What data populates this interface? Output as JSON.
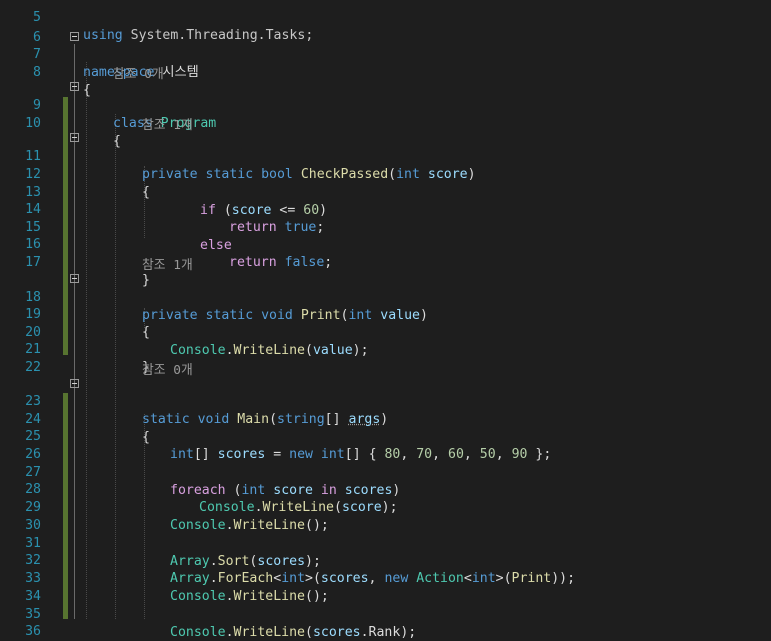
{
  "editor": {
    "line_numbers": [
      "5",
      "6",
      "7",
      "8",
      "9",
      "10",
      "11",
      "12",
      "13",
      "14",
      "15",
      "16",
      "17",
      "18",
      "19",
      "20",
      "21",
      "22",
      "23",
      "24",
      "25",
      "26",
      "27",
      "28",
      "29",
      "30",
      "31",
      "32",
      "33",
      "34",
      "35",
      "36"
    ],
    "codelens": {
      "program": "참조 0개",
      "check_passed": "참조 1개",
      "print": "참조 1개",
      "main": "참조 0개"
    },
    "lines": {
      "l5_using": "using",
      "l5_rest": " System.Threading.Tasks;",
      "l7_kw": "namespace",
      "l7_name": " 시스템",
      "l8": "{",
      "l9_kw": "class",
      "l9_name": "Program",
      "l10": "{",
      "l11_kw": "private static bool",
      "l11_method": "CheckPassed",
      "l11_p1": "(",
      "l11_type": "int",
      "l11_param": "score",
      "l11_p2": ")",
      "l12": "{",
      "l13_kw": "if",
      "l13_p1": " (",
      "l13_var": "score",
      "l13_op": " <= ",
      "l13_num": "60",
      "l13_p2": ")",
      "l14_kw": "return",
      "l14_val": "true",
      "l14_semi": ";",
      "l15_kw": "else",
      "l16_kw": "return",
      "l16_val": "false",
      "l16_semi": ";",
      "l17": "}",
      "l18_kw": "private static void",
      "l18_method": "Print",
      "l18_p1": "(",
      "l18_type": "int",
      "l18_param": "value",
      "l18_p2": ")",
      "l19": "{",
      "l20_type": "Console",
      "l20_dot": ".",
      "l20_method": "WriteLine",
      "l20_p1": "(",
      "l20_var": "value",
      "l20_p2": ");",
      "l21": "}",
      "l23_kw": "static void",
      "l23_method": "Main",
      "l23_p1": "(",
      "l23_type": "string",
      "l23_br": "[]",
      "l23_param": "args",
      "l23_p2": ")",
      "l24": "{",
      "l25_type": "int",
      "l25_br": "[]",
      "l25_var": "scores",
      "l25_eq": " = ",
      "l25_new": "new",
      "l25_type2": "int",
      "l25_br2": "[] { ",
      "l25_n1": "80",
      "l25_n2": "70",
      "l25_n3": "60",
      "l25_n4": "50",
      "l25_n5": "90",
      "l25_end": " };",
      "l25_comma": ", ",
      "l27_kw": "foreach",
      "l27_p1": " (",
      "l27_type": "int",
      "l27_var": "score",
      "l27_in": "in",
      "l27_var2": "scores",
      "l27_p2": ")",
      "l28_type": "Console",
      "l28_dot": ".",
      "l28_method": "WriteLine",
      "l28_p1": "(",
      "l28_var": "score",
      "l28_p2": ");",
      "l29_type": "Console",
      "l29_dot": ".",
      "l29_method": "WriteLine",
      "l29_p": "();",
      "l31_type": "Array",
      "l31_dot": ".",
      "l31_method": "Sort",
      "l31_p1": "(",
      "l31_var": "scores",
      "l31_p2": ");",
      "l32_type": "Array",
      "l32_dot": ".",
      "l32_method": "ForEach",
      "l32_lt": "<",
      "l32_int": "int",
      "l32_gt": ">(",
      "l32_var": "scores",
      "l32_comma": ", ",
      "l32_new": "new",
      "l32_action": "Action",
      "l32_lt2": "<",
      "l32_int2": "int",
      "l32_gt2": ">(",
      "l32_print": "Print",
      "l32_end": "));",
      "l33_type": "Console",
      "l33_dot": ".",
      "l33_method": "WriteLine",
      "l33_p": "();",
      "l35_type": "Console",
      "l35_dot": ".",
      "l35_method": "WriteLine",
      "l35_p1": "(",
      "l35_var": "scores",
      "l35_dot2": ".",
      "l35_prop": "Rank",
      "l35_p2": ");"
    }
  }
}
